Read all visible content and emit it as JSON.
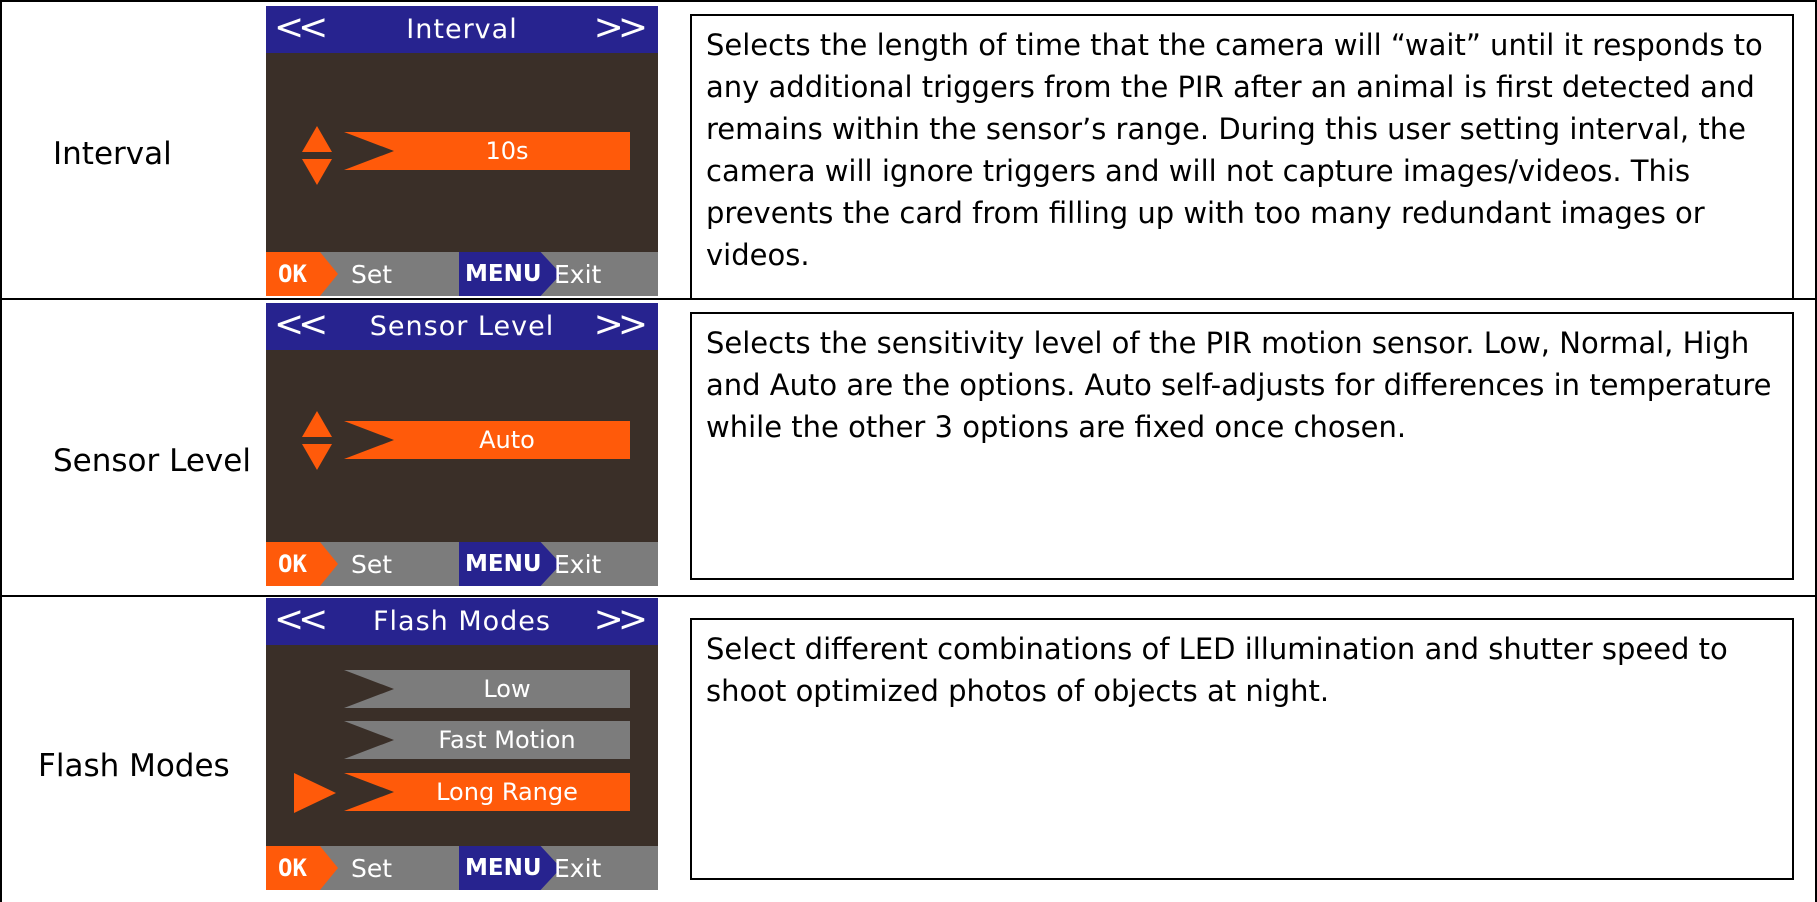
{
  "page": {
    "title": ""
  },
  "rows": [
    {
      "label": "Interval",
      "screen": {
        "nav_left": "<<",
        "header": "Interval",
        "nav_right": ">>",
        "value": "10s",
        "ok": "OK",
        "set": "Set",
        "menu": "MENU",
        "exit": "Exit"
      },
      "description": "Selects the length of time that the camera will “wait” until it responds to any additional triggers from the PIR after an animal is first detected and remains within the sensor’s range.  During this user setting interval, the camera will ignore triggers and will not capture images/videos.  This prevents the card from filling up with too many redundant images or videos."
    },
    {
      "label": "Sensor Level",
      "screen": {
        "nav_left": "<<",
        "header": "Sensor Level",
        "nav_right": ">>",
        "value": "Auto",
        "ok": "OK",
        "set": "Set",
        "menu": "MENU",
        "exit": "Exit"
      },
      "description": "Selects the sensitivity level of the PIR motion sensor.  Low, Normal, High and Auto are the options.  Auto self-adjusts for differences in temperature while the other 3 options are fixed once chosen."
    },
    {
      "label": "Flash Modes",
      "screen": {
        "nav_left": "<<",
        "header": "Flash Modes",
        "nav_right": ">>",
        "options": [
          "Low",
          "Fast Motion",
          "Long Range"
        ],
        "selected_index": 2,
        "ok": "OK",
        "set": "Set",
        "menu": "MENU",
        "exit": "Exit"
      },
      "description": "Select different combinations of LED illumination and shutter speed to shoot optimized photos of objects at night."
    }
  ],
  "colors": {
    "header_bg": "#27238f",
    "screen_bg": "#3a2f28",
    "accent": "#ff5a0a",
    "footer_bg": "#7c7c7c"
  },
  "icons": [
    "double-chevron-left-icon",
    "double-chevron-right-icon",
    "up-down-arrow-icon",
    "selection-arrow-icon"
  ]
}
